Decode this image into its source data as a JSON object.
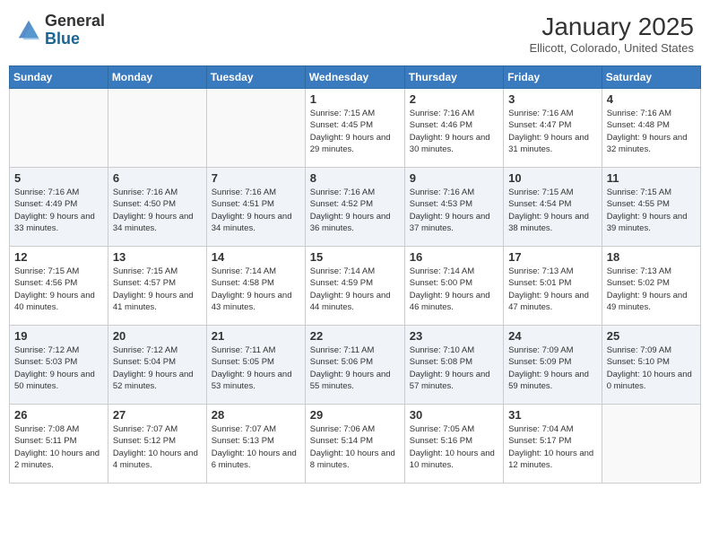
{
  "header": {
    "logo_general": "General",
    "logo_blue": "Blue",
    "month": "January 2025",
    "location": "Ellicott, Colorado, United States"
  },
  "columns": [
    "Sunday",
    "Monday",
    "Tuesday",
    "Wednesday",
    "Thursday",
    "Friday",
    "Saturday"
  ],
  "weeks": [
    [
      {
        "day": "",
        "info": ""
      },
      {
        "day": "",
        "info": ""
      },
      {
        "day": "",
        "info": ""
      },
      {
        "day": "1",
        "info": "Sunrise: 7:15 AM\nSunset: 4:45 PM\nDaylight: 9 hours and 29 minutes."
      },
      {
        "day": "2",
        "info": "Sunrise: 7:16 AM\nSunset: 4:46 PM\nDaylight: 9 hours and 30 minutes."
      },
      {
        "day": "3",
        "info": "Sunrise: 7:16 AM\nSunset: 4:47 PM\nDaylight: 9 hours and 31 minutes."
      },
      {
        "day": "4",
        "info": "Sunrise: 7:16 AM\nSunset: 4:48 PM\nDaylight: 9 hours and 32 minutes."
      }
    ],
    [
      {
        "day": "5",
        "info": "Sunrise: 7:16 AM\nSunset: 4:49 PM\nDaylight: 9 hours and 33 minutes."
      },
      {
        "day": "6",
        "info": "Sunrise: 7:16 AM\nSunset: 4:50 PM\nDaylight: 9 hours and 34 minutes."
      },
      {
        "day": "7",
        "info": "Sunrise: 7:16 AM\nSunset: 4:51 PM\nDaylight: 9 hours and 34 minutes."
      },
      {
        "day": "8",
        "info": "Sunrise: 7:16 AM\nSunset: 4:52 PM\nDaylight: 9 hours and 36 minutes."
      },
      {
        "day": "9",
        "info": "Sunrise: 7:16 AM\nSunset: 4:53 PM\nDaylight: 9 hours and 37 minutes."
      },
      {
        "day": "10",
        "info": "Sunrise: 7:15 AM\nSunset: 4:54 PM\nDaylight: 9 hours and 38 minutes."
      },
      {
        "day": "11",
        "info": "Sunrise: 7:15 AM\nSunset: 4:55 PM\nDaylight: 9 hours and 39 minutes."
      }
    ],
    [
      {
        "day": "12",
        "info": "Sunrise: 7:15 AM\nSunset: 4:56 PM\nDaylight: 9 hours and 40 minutes."
      },
      {
        "day": "13",
        "info": "Sunrise: 7:15 AM\nSunset: 4:57 PM\nDaylight: 9 hours and 41 minutes."
      },
      {
        "day": "14",
        "info": "Sunrise: 7:14 AM\nSunset: 4:58 PM\nDaylight: 9 hours and 43 minutes."
      },
      {
        "day": "15",
        "info": "Sunrise: 7:14 AM\nSunset: 4:59 PM\nDaylight: 9 hours and 44 minutes."
      },
      {
        "day": "16",
        "info": "Sunrise: 7:14 AM\nSunset: 5:00 PM\nDaylight: 9 hours and 46 minutes."
      },
      {
        "day": "17",
        "info": "Sunrise: 7:13 AM\nSunset: 5:01 PM\nDaylight: 9 hours and 47 minutes."
      },
      {
        "day": "18",
        "info": "Sunrise: 7:13 AM\nSunset: 5:02 PM\nDaylight: 9 hours and 49 minutes."
      }
    ],
    [
      {
        "day": "19",
        "info": "Sunrise: 7:12 AM\nSunset: 5:03 PM\nDaylight: 9 hours and 50 minutes."
      },
      {
        "day": "20",
        "info": "Sunrise: 7:12 AM\nSunset: 5:04 PM\nDaylight: 9 hours and 52 minutes."
      },
      {
        "day": "21",
        "info": "Sunrise: 7:11 AM\nSunset: 5:05 PM\nDaylight: 9 hours and 53 minutes."
      },
      {
        "day": "22",
        "info": "Sunrise: 7:11 AM\nSunset: 5:06 PM\nDaylight: 9 hours and 55 minutes."
      },
      {
        "day": "23",
        "info": "Sunrise: 7:10 AM\nSunset: 5:08 PM\nDaylight: 9 hours and 57 minutes."
      },
      {
        "day": "24",
        "info": "Sunrise: 7:09 AM\nSunset: 5:09 PM\nDaylight: 9 hours and 59 minutes."
      },
      {
        "day": "25",
        "info": "Sunrise: 7:09 AM\nSunset: 5:10 PM\nDaylight: 10 hours and 0 minutes."
      }
    ],
    [
      {
        "day": "26",
        "info": "Sunrise: 7:08 AM\nSunset: 5:11 PM\nDaylight: 10 hours and 2 minutes."
      },
      {
        "day": "27",
        "info": "Sunrise: 7:07 AM\nSunset: 5:12 PM\nDaylight: 10 hours and 4 minutes."
      },
      {
        "day": "28",
        "info": "Sunrise: 7:07 AM\nSunset: 5:13 PM\nDaylight: 10 hours and 6 minutes."
      },
      {
        "day": "29",
        "info": "Sunrise: 7:06 AM\nSunset: 5:14 PM\nDaylight: 10 hours and 8 minutes."
      },
      {
        "day": "30",
        "info": "Sunrise: 7:05 AM\nSunset: 5:16 PM\nDaylight: 10 hours and 10 minutes."
      },
      {
        "day": "31",
        "info": "Sunrise: 7:04 AM\nSunset: 5:17 PM\nDaylight: 10 hours and 12 minutes."
      },
      {
        "day": "",
        "info": ""
      }
    ]
  ]
}
